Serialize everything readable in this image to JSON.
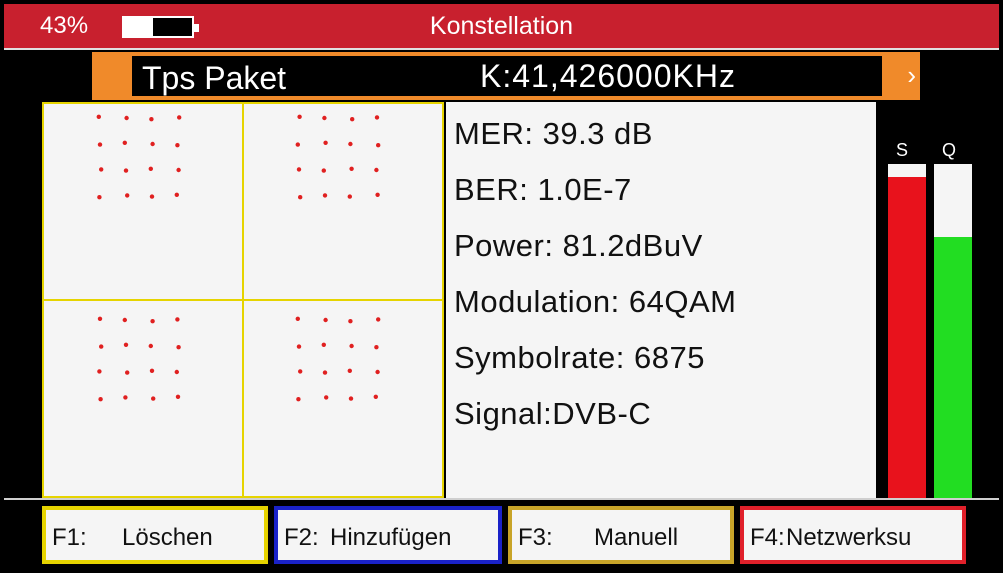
{
  "status": {
    "battery_percent": "43%",
    "battery_level": 0.43
  },
  "title": "Konstellation",
  "transponder": {
    "name": "Tps Paket",
    "frequency": "K:41,426000KHz",
    "arrow": "›"
  },
  "info": {
    "rows": [
      "MER: 39.3 dB",
      "BER: 1.0E-7",
      "Power: 81.2dBuV",
      "Modulation: 64QAM",
      "Symbolrate: 6875",
      "Signal:DVB-C"
    ]
  },
  "meters": {
    "strength": {
      "label": "S",
      "level": 0.96,
      "color": "#e8121c"
    },
    "quality": {
      "label": "Q",
      "level": 0.78,
      "color": "#22dd22"
    }
  },
  "fkeys": [
    {
      "key": "F1:",
      "label": "Löschen",
      "color": "#e6d400"
    },
    {
      "key": "F2:",
      "label": "Hinzufügen",
      "color": "#1a22c8"
    },
    {
      "key": "F3:",
      "label": "Manuell",
      "color": "#c8a428"
    },
    {
      "key": "F4:",
      "label": "Netzwerksu",
      "color": "#e0202a"
    }
  ],
  "colors": {
    "accent_red": "#c8202e",
    "tp_bar_orange": "#f08a2a",
    "grid_yellow": "#e6d400",
    "constellation_dot": "#e02020"
  },
  "constellation": {
    "modulation_points": 64
  }
}
